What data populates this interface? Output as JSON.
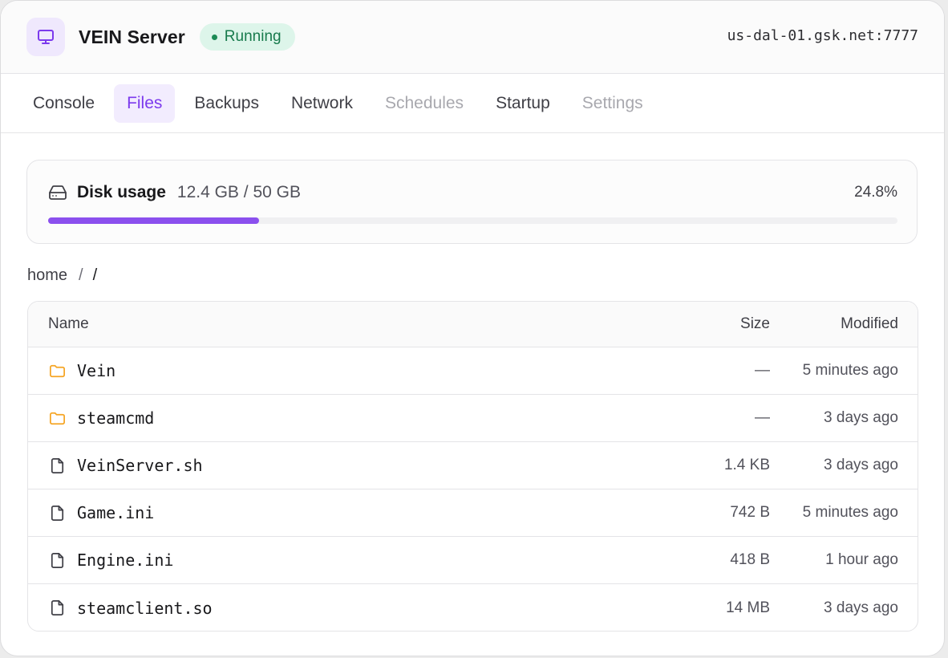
{
  "header": {
    "server_name": "VEIN Server",
    "status": "Running",
    "address": "us-dal-01.gsk.net:7777",
    "icon": "monitor-icon"
  },
  "tabs": [
    {
      "label": "Console",
      "state": "normal"
    },
    {
      "label": "Files",
      "state": "active"
    },
    {
      "label": "Backups",
      "state": "normal"
    },
    {
      "label": "Network",
      "state": "normal"
    },
    {
      "label": "Schedules",
      "state": "disabled"
    },
    {
      "label": "Startup",
      "state": "normal"
    },
    {
      "label": "Settings",
      "state": "disabled"
    }
  ],
  "disk": {
    "title": "Disk usage",
    "value": "12.4 GB / 50 GB",
    "percent_label": "24.8%",
    "fraction": 0.248,
    "icon": "hard-drive-icon"
  },
  "breadcrumb": {
    "root": "home",
    "separator": "/",
    "current": "/"
  },
  "table": {
    "headers": {
      "name": "Name",
      "size": "Size",
      "modified": "Modified"
    },
    "rows": [
      {
        "name": "Vein",
        "type": "folder",
        "size": "—",
        "modified": "5 minutes ago"
      },
      {
        "name": "steamcmd",
        "type": "folder",
        "size": "—",
        "modified": "3 days ago"
      },
      {
        "name": "VeinServer.sh",
        "type": "file",
        "size": "1.4 KB",
        "modified": "3 days ago"
      },
      {
        "name": "Game.ini",
        "type": "file",
        "size": "742 B",
        "modified": "5 minutes ago"
      },
      {
        "name": "Engine.ini",
        "type": "file",
        "size": "418 B",
        "modified": "1 hour ago"
      },
      {
        "name": "steamclient.so",
        "type": "file",
        "size": "14 MB",
        "modified": "3 days ago"
      }
    ]
  },
  "colors": {
    "accent": "#7c3aed",
    "progress": "#8b50ee",
    "status_bg": "#ddf5ea",
    "status_text": "#177a4c",
    "folder": "#f5a524"
  }
}
